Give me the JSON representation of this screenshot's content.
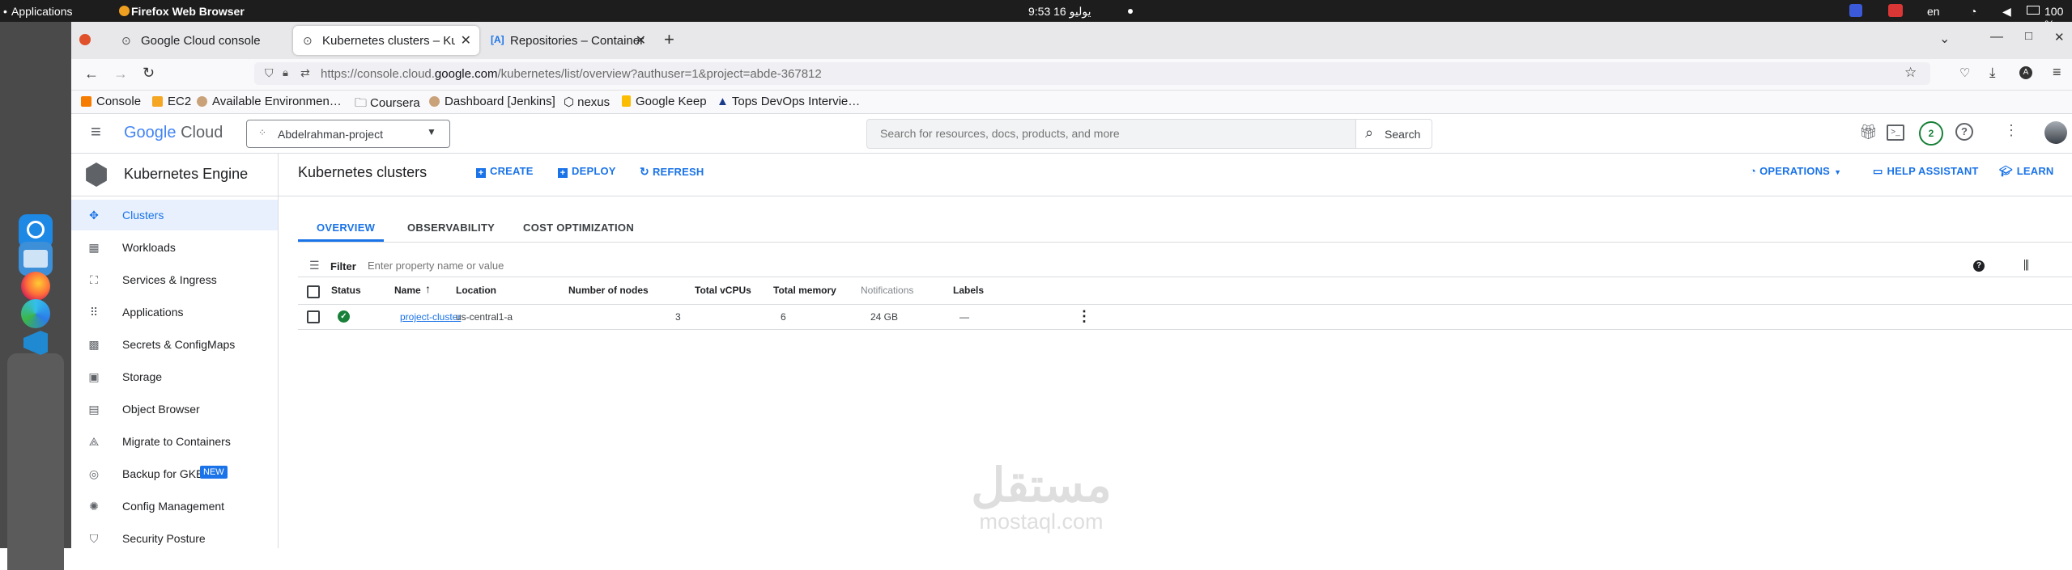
{
  "os": {
    "activities": "Applications",
    "active_app": "Firefox Web Browser",
    "clock": "9:53 16 يوليو",
    "lang": "en",
    "battery": "100 %"
  },
  "browser": {
    "tabs": [
      {
        "title": "Google Cloud console"
      },
      {
        "title": "Kubernetes clusters – Kub"
      },
      {
        "title": "Repositories – Container"
      }
    ],
    "new_tab": "+",
    "url": {
      "prefix": "https://console.cloud.",
      "domain": "google.com",
      "suffix": "/kubernetes/list/overview?authuser=1&project=abde-367812"
    },
    "bookmarks": [
      "Console",
      "EC2",
      "Available Environmen…",
      "Coursera",
      "Dashboard [Jenkins]",
      "nexus",
      "Google Keep",
      "Tops DevOps Intervie…"
    ]
  },
  "gcp": {
    "logo": {
      "google": "Google",
      "cloud": "Cloud"
    },
    "project": "Abdelrahman-project",
    "search_placeholder": "Search for resources, docs, products, and more",
    "search_button": "Search",
    "notifications_count": "2",
    "product": "Kubernetes Engine",
    "page_title": "Kubernetes clusters",
    "actions": {
      "create": "CREATE",
      "deploy": "DEPLOY",
      "refresh": "REFRESH"
    },
    "right_actions": {
      "operations": "OPERATIONS",
      "help": "HELP ASSISTANT",
      "learn": "LEARN"
    },
    "nav": [
      {
        "label": "Clusters",
        "icon": "clusters-icon"
      },
      {
        "label": "Workloads",
        "icon": "workloads-icon"
      },
      {
        "label": "Services & Ingress",
        "icon": "services-icon"
      },
      {
        "label": "Applications",
        "icon": "applications-icon"
      },
      {
        "label": "Secrets & ConfigMaps",
        "icon": "secrets-icon"
      },
      {
        "label": "Storage",
        "icon": "storage-icon"
      },
      {
        "label": "Object Browser",
        "icon": "object-browser-icon"
      },
      {
        "label": "Migrate to Containers",
        "icon": "migrate-icon"
      },
      {
        "label": "Backup for GKE",
        "icon": "backup-icon",
        "badge": "NEW"
      },
      {
        "label": "Config Management",
        "icon": "config-icon"
      },
      {
        "label": "Security Posture",
        "icon": "security-icon"
      }
    ],
    "tabs": [
      "OVERVIEW",
      "OBSERVABILITY",
      "COST OPTIMIZATION"
    ],
    "filter": {
      "label": "Filter",
      "placeholder": "Enter property name or value"
    },
    "table": {
      "headers": {
        "status": "Status",
        "name": "Name",
        "location": "Location",
        "nodes": "Number of nodes",
        "vcpus": "Total vCPUs",
        "memory": "Total memory",
        "notifications": "Notifications",
        "labels": "Labels"
      },
      "rows": [
        {
          "name": "project-cluster",
          "location": "us-central1-a",
          "nodes": "3",
          "vcpus": "6",
          "memory": "24 GB",
          "notifications": "",
          "labels": "—"
        }
      ]
    },
    "colors": {
      "accent": "#1a73e8",
      "success": "#188038",
      "selected_bg": "#e8f0fe"
    }
  },
  "watermark": {
    "arabic": "مستقل",
    "latin": "mostaql.com"
  }
}
